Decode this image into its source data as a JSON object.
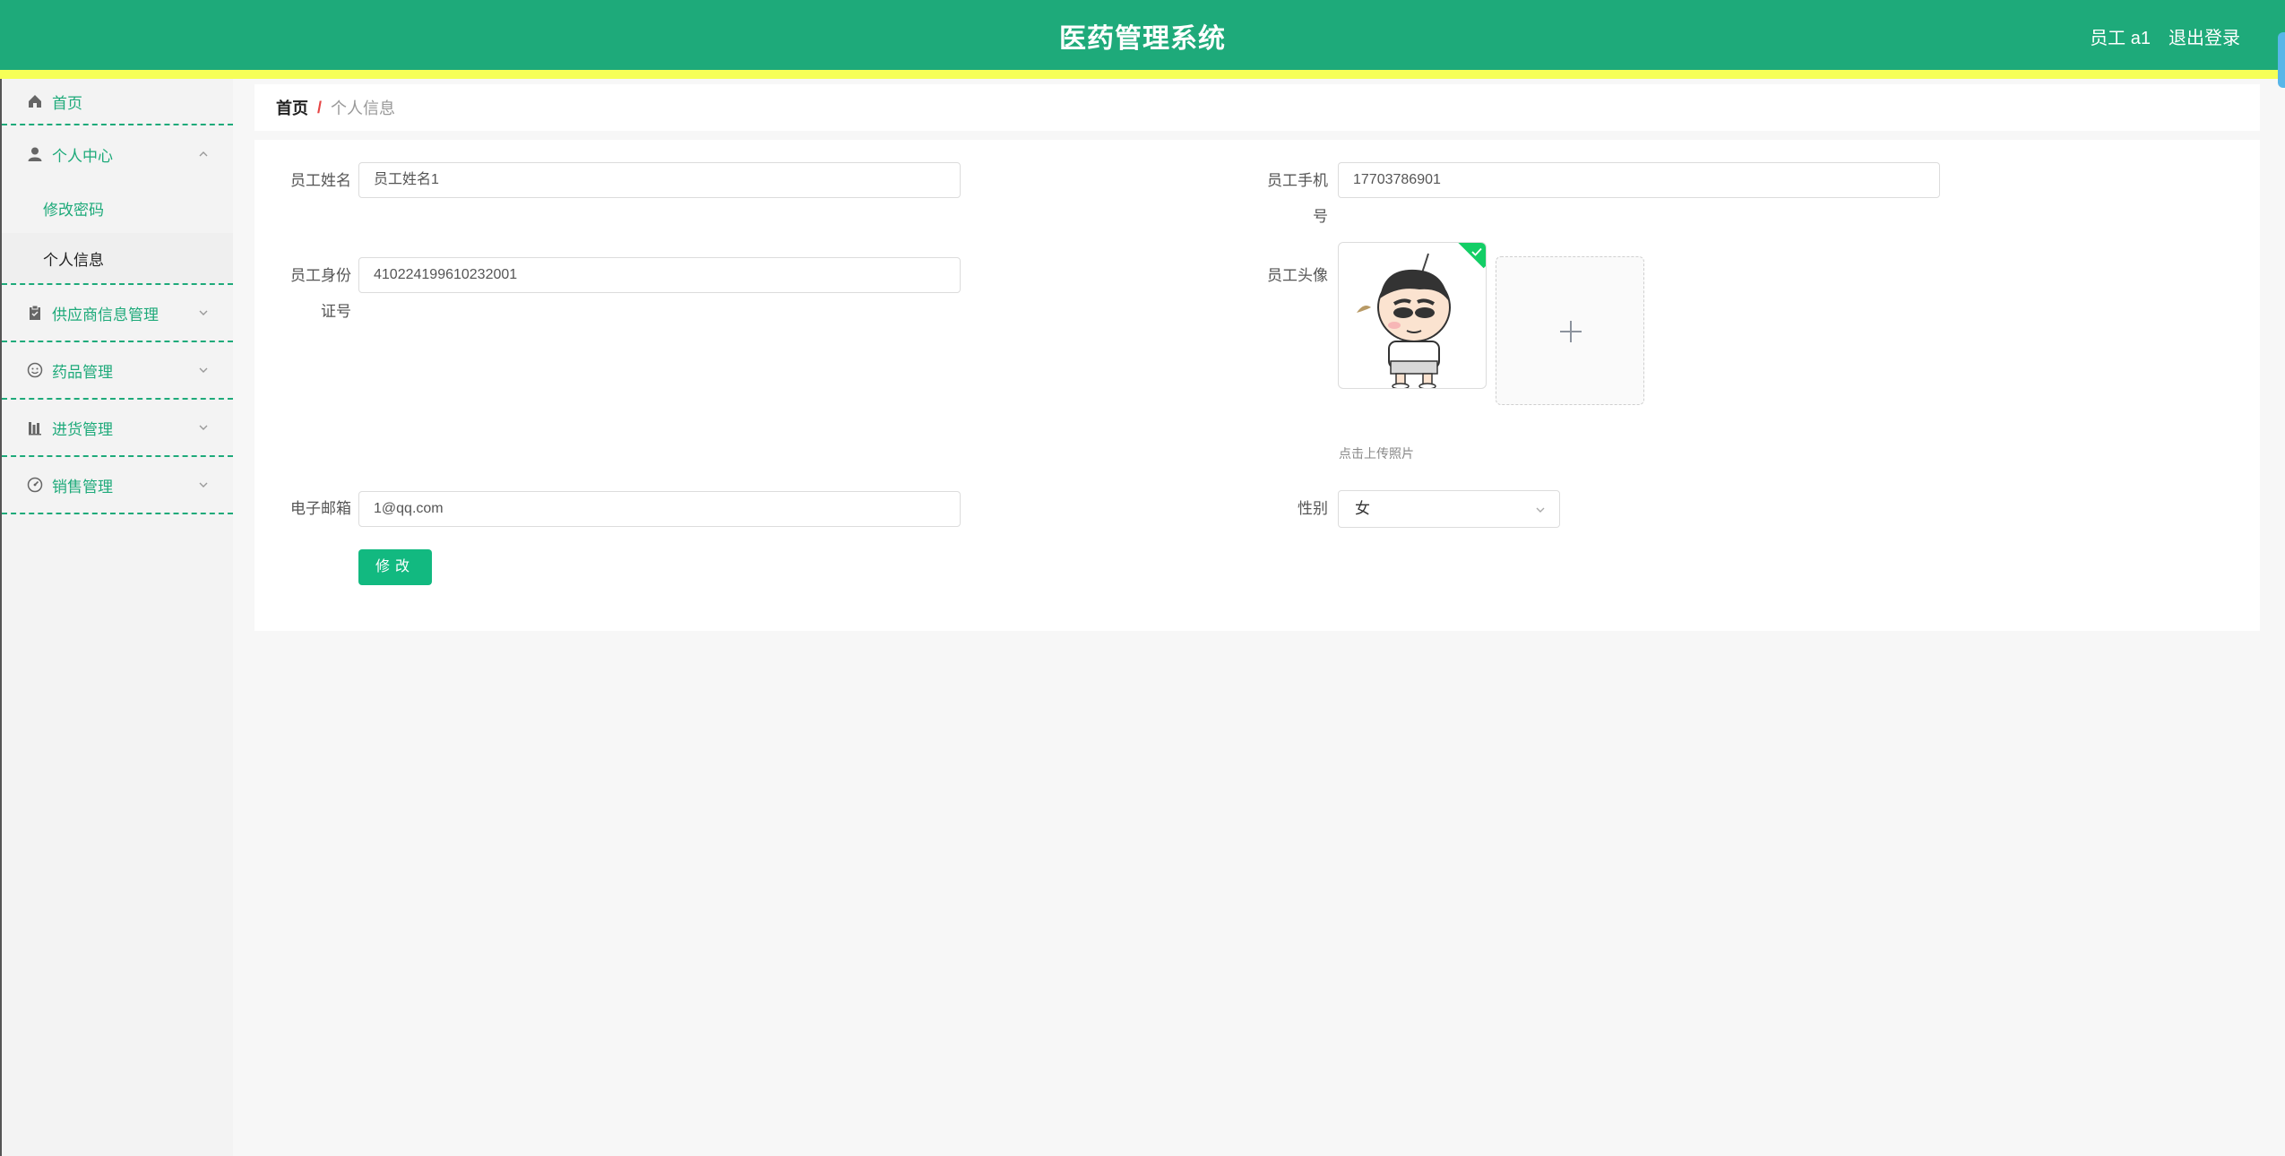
{
  "header": {
    "title": "医药管理系统",
    "user": "员工 a1",
    "logout": "退出登录"
  },
  "colors": {
    "primary": "#1eaa7a",
    "stripe": "#f6ff57",
    "button": "#12b980"
  },
  "sidebar": {
    "items": [
      {
        "label": "首页",
        "icon": "home-icon"
      },
      {
        "label": "个人中心",
        "icon": "user-icon",
        "expanded": true,
        "children": [
          {
            "label": "修改密码",
            "active": false
          },
          {
            "label": "个人信息",
            "active": true
          }
        ]
      },
      {
        "label": "供应商信息管理",
        "icon": "clipboard-icon"
      },
      {
        "label": "药品管理",
        "icon": "emoji-icon"
      },
      {
        "label": "进货管理",
        "icon": "chart-icon"
      },
      {
        "label": "销售管理",
        "icon": "gauge-icon"
      }
    ]
  },
  "breadcrumb": {
    "home": "首页",
    "separator": "/",
    "current": "个人信息"
  },
  "form": {
    "name_label": "员工姓名",
    "name_value": "员工姓名1",
    "phone_label_1": "员工手机",
    "phone_label_2": "号",
    "phone_value": "17703786901",
    "idcard_label_1": "员工身份",
    "idcard_label_2": "证号",
    "idcard_value": "410224199610232001",
    "avatar_label": "员工头像",
    "upload_tip": "点击上传照片",
    "email_label": "电子邮箱",
    "email_value": "1@qq.com",
    "gender_label": "性别",
    "gender_value": "女",
    "submit_label": "修改"
  }
}
